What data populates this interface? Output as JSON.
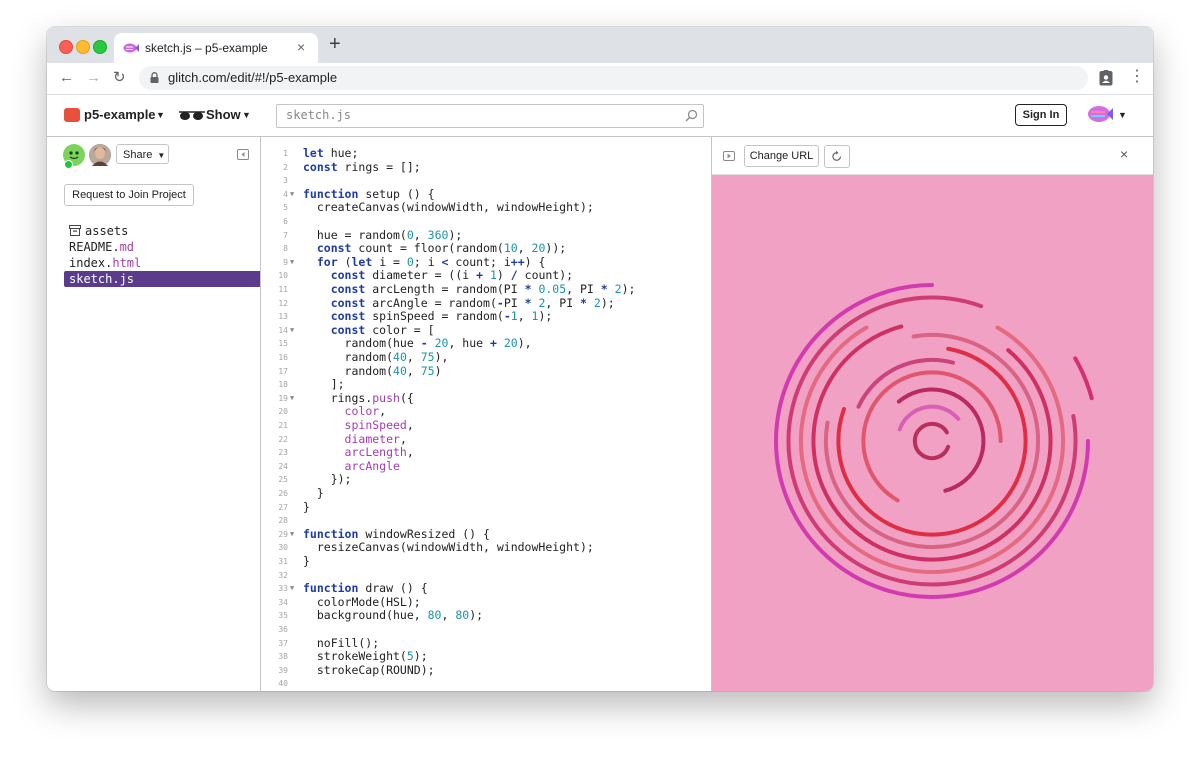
{
  "browser": {
    "tab_title": "sketch.js – p5-example",
    "tab_close": "×",
    "new_tab": "+",
    "url": "glitch.com/edit/#!/p5-example",
    "back": "←",
    "forward": "→",
    "reload": "↻",
    "menu": "⋮"
  },
  "header": {
    "project_name": "p5-example",
    "show_label": "Show",
    "search_value": "sketch.js",
    "sign_in": "Sign In"
  },
  "sidebar": {
    "share_label": "Share",
    "join_label": "Request to Join Project",
    "files": [
      {
        "name": "assets",
        "ext": ""
      },
      {
        "name": "README.",
        "ext": "md"
      },
      {
        "name": "index.",
        "ext": "html"
      },
      {
        "name": "sketch.js",
        "ext": ""
      }
    ]
  },
  "editor": {
    "lines": [
      {
        "n": "1",
        "fold": false,
        "code": "<k>let</k> hue;"
      },
      {
        "n": "2",
        "fold": false,
        "code": "<k>const</k> rings = [];"
      },
      {
        "n": "3",
        "fold": false,
        "code": ""
      },
      {
        "n": "4",
        "fold": true,
        "code": "<k>function</k> setup () {"
      },
      {
        "n": "5",
        "fold": false,
        "code": "  createCanvas(windowWidth, windowHeight);"
      },
      {
        "n": "6",
        "fold": false,
        "code": ""
      },
      {
        "n": "7",
        "fold": false,
        "code": "  hue = random(<n>0</n>, <n>360</n>);"
      },
      {
        "n": "8",
        "fold": false,
        "code": "  <k>const</k> count = floor(random(<n>10</n>, <n>20</n>));"
      },
      {
        "n": "9",
        "fold": true,
        "code": "  <k>for</k> (<k>let</k> i = <n>0</n>; i <k><</k> count; i<k>++</k>) {"
      },
      {
        "n": "10",
        "fold": false,
        "code": "    <k>const</k> diameter = ((i <k>+</k> <n>1</n>) <k>/</k> count);"
      },
      {
        "n": "11",
        "fold": false,
        "code": "    <k>const</k> arcLength = random(PI <k>*</k> <n>0.05</n>, PI <k>*</k> <n>2</n>);"
      },
      {
        "n": "12",
        "fold": false,
        "code": "    <k>const</k> arcAngle = random(<k>-</k>PI <k>*</k> <n>2</n>, PI <k>*</k> <n>2</n>);"
      },
      {
        "n": "13",
        "fold": false,
        "code": "    <k>const</k> spinSpeed = random(<k>-</k><n>1</n>, <n>1</n>);"
      },
      {
        "n": "14",
        "fold": true,
        "code": "    <k>const</k> color = ["
      },
      {
        "n": "15",
        "fold": false,
        "code": "      random(hue <k>-</k> <n>20</n>, hue <k>+</k> <n>20</n>),"
      },
      {
        "n": "16",
        "fold": false,
        "code": "      random(<n>40</n>, <n>75</n>),"
      },
      {
        "n": "17",
        "fold": false,
        "code": "      random(<n>40</n>, <n>75</n>)"
      },
      {
        "n": "18",
        "fold": false,
        "code": "    ];"
      },
      {
        "n": "19",
        "fold": true,
        "code": "    rings.<p>push</p>({"
      },
      {
        "n": "20",
        "fold": false,
        "code": "      <p>color</p>,"
      },
      {
        "n": "21",
        "fold": false,
        "code": "      <p>spinSpeed</p>,"
      },
      {
        "n": "22",
        "fold": false,
        "code": "      <p>diameter</p>,"
      },
      {
        "n": "23",
        "fold": false,
        "code": "      <p>arcLength</p>,"
      },
      {
        "n": "24",
        "fold": false,
        "code": "      <p>arcAngle</p>"
      },
      {
        "n": "25",
        "fold": false,
        "code": "    });"
      },
      {
        "n": "26",
        "fold": false,
        "code": "  }"
      },
      {
        "n": "27",
        "fold": false,
        "code": "}"
      },
      {
        "n": "28",
        "fold": false,
        "code": ""
      },
      {
        "n": "29",
        "fold": true,
        "code": "<k>function</k> windowResized () {"
      },
      {
        "n": "30",
        "fold": false,
        "code": "  resizeCanvas(windowWidth, windowHeight);"
      },
      {
        "n": "31",
        "fold": false,
        "code": "}"
      },
      {
        "n": "32",
        "fold": false,
        "code": ""
      },
      {
        "n": "33",
        "fold": true,
        "code": "<k>function</k> draw () {"
      },
      {
        "n": "34",
        "fold": false,
        "code": "  colorMode(HSL);"
      },
      {
        "n": "35",
        "fold": false,
        "code": "  background(hue, <n>80</n>, <n>80</n>);"
      },
      {
        "n": "36",
        "fold": false,
        "code": ""
      },
      {
        "n": "37",
        "fold": false,
        "code": "  noFill();"
      },
      {
        "n": "38",
        "fold": false,
        "code": "  strokeWeight(<n>5</n>);"
      },
      {
        "n": "39",
        "fold": false,
        "code": "  strokeCap(ROUND);"
      },
      {
        "n": "40",
        "fold": false,
        "code": ""
      }
    ]
  },
  "preview": {
    "change_url": "Change URL",
    "close": "×",
    "background_color": "#f1a1c4",
    "rings": [
      {
        "diameter": 0.11,
        "start_deg": 20,
        "end_deg": 330,
        "color": "#b8305a"
      },
      {
        "diameter": 0.22,
        "start_deg": 200,
        "end_deg": 320,
        "color": "#d760b5"
      },
      {
        "diameter": 0.33,
        "start_deg": 230,
        "end_deg": 75,
        "color": "#ba2a5e"
      },
      {
        "diameter": 0.44,
        "start_deg": 120,
        "end_deg": 360,
        "color": "#e0566e"
      },
      {
        "diameter": 0.52,
        "start_deg": 205,
        "end_deg": 285,
        "color": "#c9437c"
      },
      {
        "diameter": 0.6,
        "start_deg": 280,
        "end_deg": 200,
        "color": "#de2d44"
      },
      {
        "diameter": 0.68,
        "start_deg": 260,
        "end_deg": 190,
        "color": "#d96382"
      },
      {
        "diameter": 0.76,
        "start_deg": 310,
        "end_deg": 255,
        "color": "#cf3062"
      },
      {
        "diameter": 0.84,
        "start_deg": 300,
        "end_deg": 240,
        "color": "#e56a80"
      },
      {
        "diameter": 0.92,
        "start_deg": 350,
        "end_deg": 290,
        "color": "#cf3c74"
      },
      {
        "diameter": 1.0,
        "start_deg": 0,
        "end_deg": 270,
        "color": "#d23bb0"
      },
      {
        "diameter": 1.06,
        "start_deg": 330,
        "end_deg": 345,
        "color": "#d4306d"
      }
    ]
  }
}
